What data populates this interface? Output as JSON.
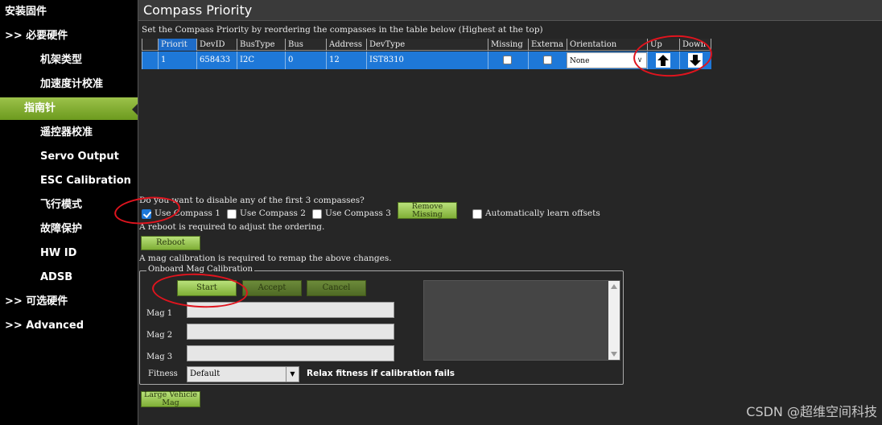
{
  "sidebar": {
    "items": [
      {
        "label": "安装固件"
      },
      {
        "label": ">> 必要硬件"
      },
      {
        "label": "机架类型"
      },
      {
        "label": "加速度计校准"
      },
      {
        "label": "指南针"
      },
      {
        "label": "遥控器校准"
      },
      {
        "label": "Servo Output"
      },
      {
        "label": "ESC Calibration"
      },
      {
        "label": "飞行模式"
      },
      {
        "label": "故障保护"
      },
      {
        "label": "HW ID"
      },
      {
        "label": "ADSB"
      },
      {
        "label": ">> 可选硬件"
      },
      {
        "label": ">> Advanced"
      }
    ]
  },
  "page": {
    "title": "Compass Priority",
    "description": "Set the Compass Priority by reordering the compasses in the table below (Highest at the top)"
  },
  "table": {
    "headers": [
      "Priorit",
      "DevID",
      "BusType",
      "Bus",
      "Address",
      "DevType",
      "Missing",
      "Externa",
      "Orientation",
      "Up",
      "Down"
    ],
    "row": {
      "priority": "1",
      "devid": "658433",
      "bustype": "I2C",
      "bus": "0",
      "address": "12",
      "devtype": "IST8310",
      "missing": false,
      "external": false,
      "orientation": "None"
    }
  },
  "disable": {
    "question": "Do you want to disable any of the first 3 compasses?",
    "use_compass_1": "Use Compass 1",
    "use_compass_2": "Use Compass 2",
    "use_compass_3": "Use Compass 3",
    "compass1_checked": true,
    "compass2_checked": false,
    "compass3_checked": false,
    "remove_missing": "Remove Missing",
    "auto_learn": "Automatically learn offsets",
    "reboot_note": "A reboot is required to adjust the ordering.",
    "reboot": "Reboot",
    "mag_note": "A mag calibration is required to remap the above changes."
  },
  "calibration": {
    "legend": "Onboard Mag Calibration",
    "start": "Start",
    "accept": "Accept",
    "cancel": "Cancel",
    "mag1": "Mag 1",
    "mag2": "Mag 2",
    "mag3": "Mag 3",
    "fitness_label": "Fitness",
    "fitness_value": "Default",
    "relax_note": "Relax fitness if calibration fails"
  },
  "large_vehicle_mag": "Large Vehicle Mag",
  "watermark": "CSDN @超维空间科技",
  "colors": {
    "accent_green": "#8fbf3f",
    "selection_blue": "#1e78d8",
    "annotation_red": "#e0141e"
  }
}
